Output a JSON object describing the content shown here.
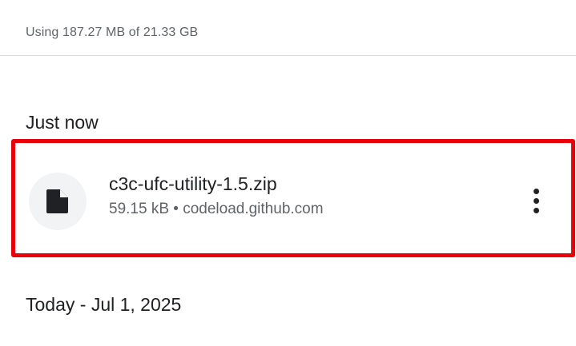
{
  "storage": {
    "usage_text": "Using 187.27 MB of 21.33 GB"
  },
  "sections": [
    {
      "heading": "Just now",
      "items": [
        {
          "file_name": "c3c-ufc-utility-1.5.zip",
          "size": "59.15 kB",
          "separator": "•",
          "source": "codeload.github.com",
          "icon": "file-icon"
        }
      ]
    },
    {
      "heading": "Today - Jul 1, 2025"
    }
  ],
  "colors": {
    "highlight_border": "#e8000b",
    "icon_background": "#f1f3f4"
  }
}
